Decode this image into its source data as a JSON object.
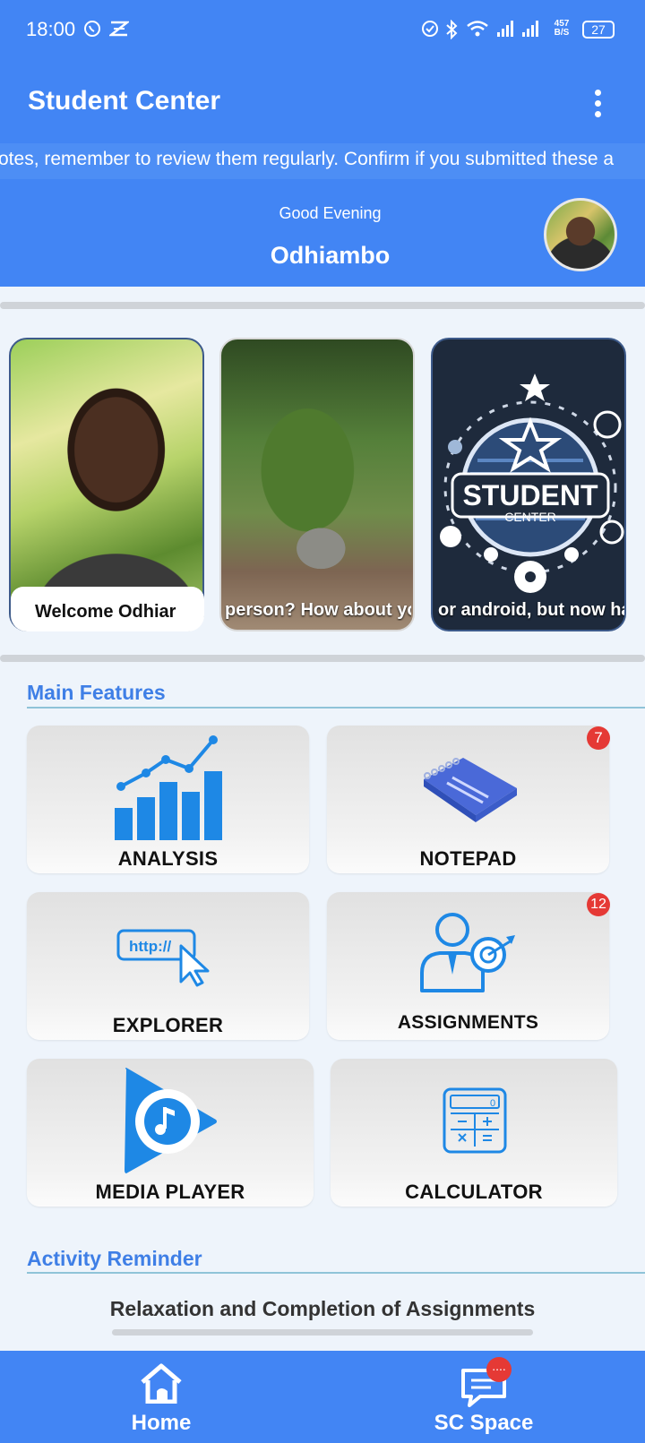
{
  "status_bar": {
    "time": "18:00",
    "net_speed_value": "457",
    "net_speed_unit": "B/S",
    "battery": "27",
    "icons": [
      "whatsapp-icon",
      "notification-icon",
      "alarm-icon",
      "bluetooth-icon",
      "wifi-icon",
      "signal-icon",
      "signal-icon",
      "battery-icon"
    ]
  },
  "app_bar": {
    "title": "Student Center",
    "menu_icon": "more-vert-icon"
  },
  "marquee": {
    "text": "otes, remember to review them regularly. Confirm if you submitted these a"
  },
  "header": {
    "greeting": "Good Evening",
    "username": "Odhiambo"
  },
  "carousel": {
    "cards": [
      {
        "caption": "Welcome Odhiar"
      },
      {
        "caption": "person? How about yo"
      },
      {
        "caption": "or android, but now has",
        "logo_text_1": "STUDENT",
        "logo_text_2": "CENTER"
      }
    ]
  },
  "main_features": {
    "title": "Main Features",
    "items": [
      {
        "label": "ANALYSIS",
        "icon": "bar-chart-icon",
        "badge": ""
      },
      {
        "label": "NOTEPAD",
        "icon": "notebook-icon",
        "badge": "7"
      },
      {
        "label": "EXPLORER",
        "icon": "browser-icon",
        "url_text": "http://",
        "badge": ""
      },
      {
        "label": "ASSIGNMENTS",
        "icon": "target-person-icon",
        "badge": "12"
      },
      {
        "label": "MEDIA PLAYER",
        "icon": "media-player-icon",
        "badge": ""
      },
      {
        "label": "CALCULATOR",
        "icon": "calculator-icon",
        "badge": "",
        "display_value": "0"
      }
    ]
  },
  "activity_reminder": {
    "title": "Activity Reminder",
    "text": "Relaxation and Completion of Assignments"
  },
  "bottom_nav": {
    "items": [
      {
        "label": "Home",
        "icon": "home-icon"
      },
      {
        "label": "SC Space",
        "icon": "chat-icon",
        "badge": "...."
      }
    ]
  },
  "colors": {
    "primary": "#4285f4",
    "accent_text": "#3f7fe6",
    "badge": "#e53935",
    "background": "#eef4fb"
  }
}
